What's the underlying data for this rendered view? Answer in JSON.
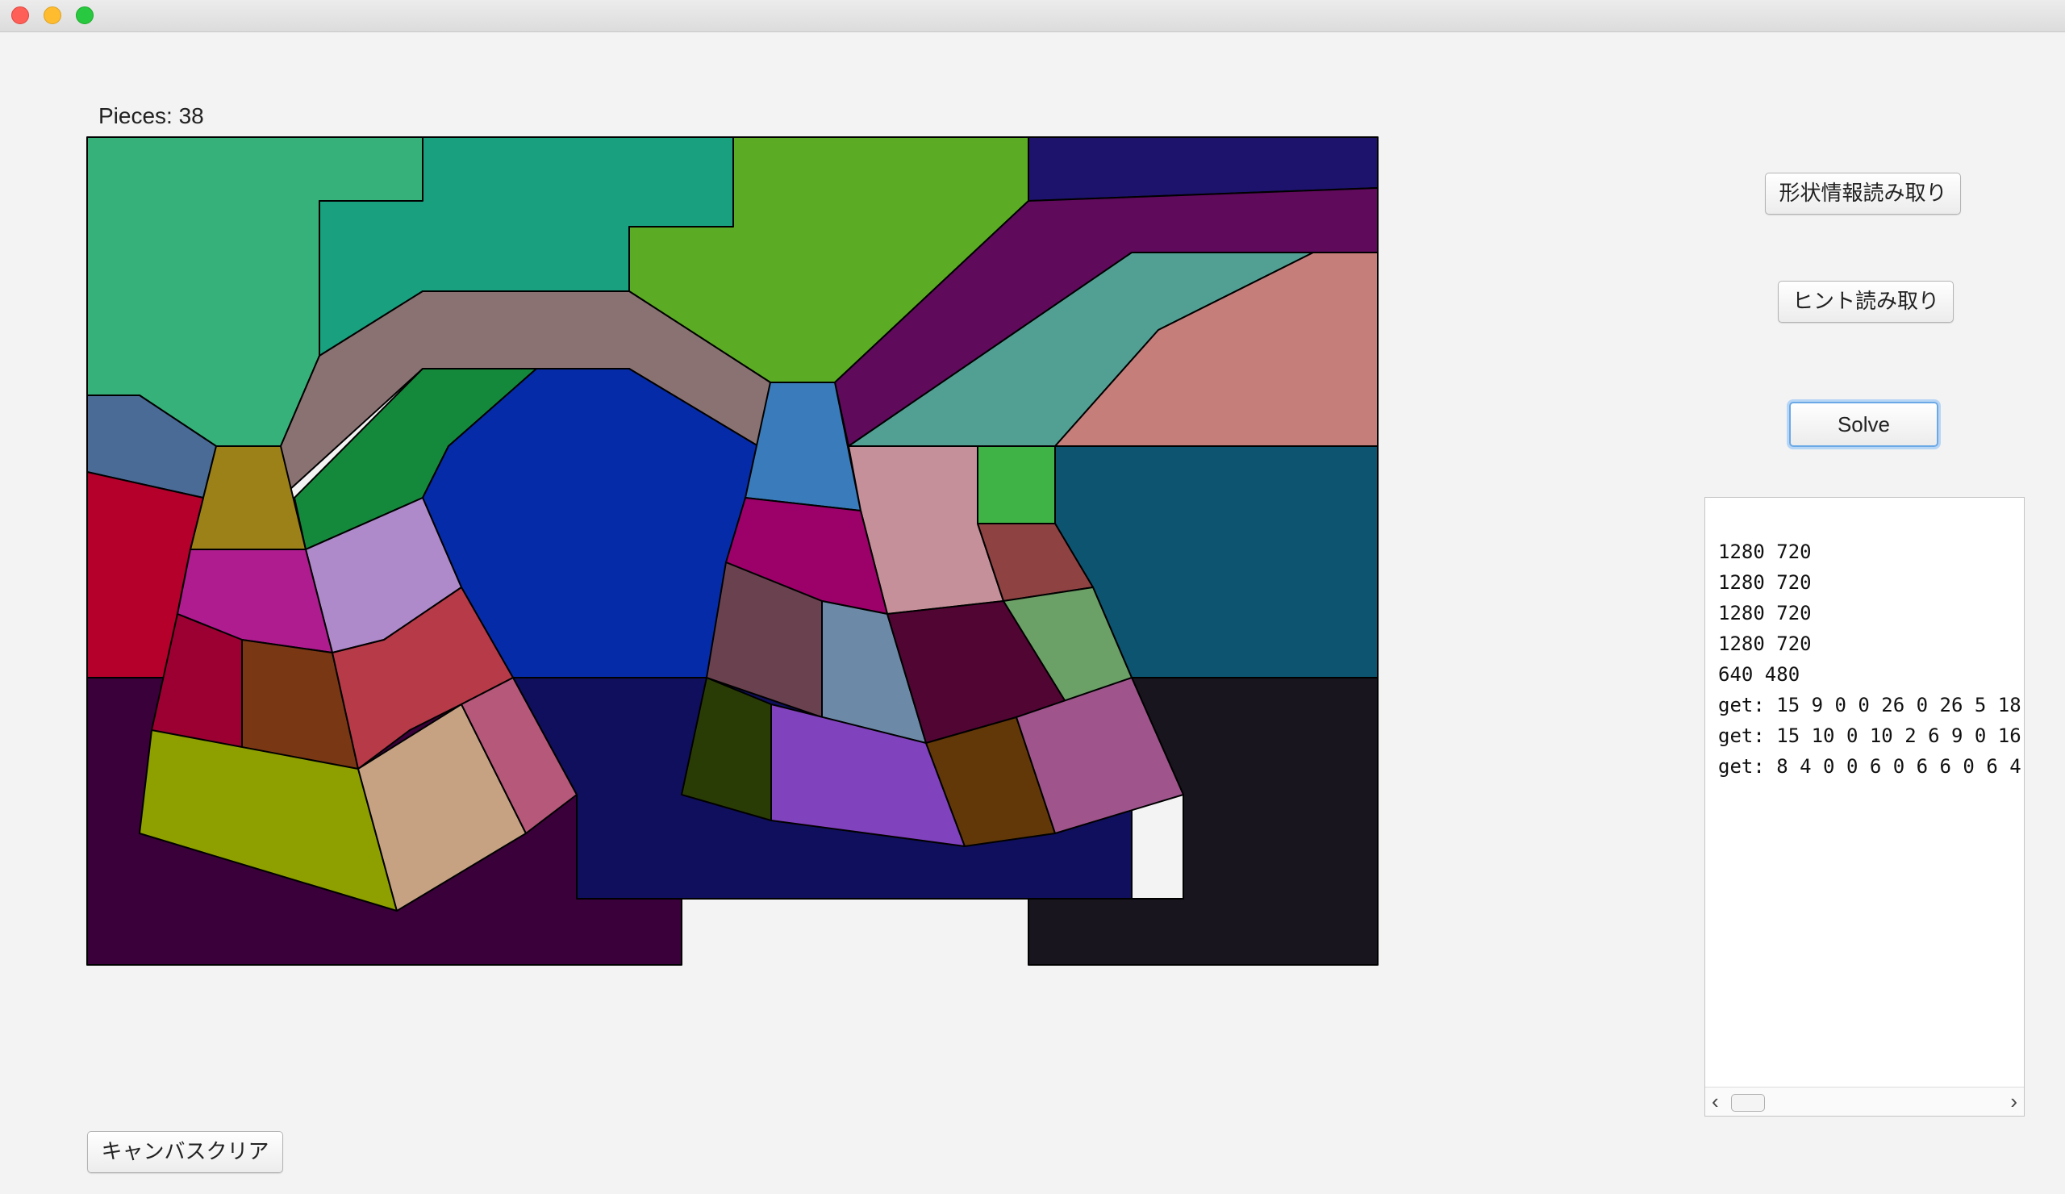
{
  "window": {
    "title": ""
  },
  "status": {
    "pieces_label": "Pieces:",
    "pieces_count": "38"
  },
  "buttons": {
    "load_shape": "形状情報読み取り",
    "load_hint": "ヒント読み取り",
    "solve": "Solve",
    "clear_canvas": "キャンバスクリア"
  },
  "console": {
    "lines": [
      "1280 720",
      "1280 720",
      "1280 720",
      "1280 720",
      "640 480",
      "get: 15 9 0 0 26 0 26 5 18",
      "get: 15 10 0 10 2 6 9 0 16",
      "get: 8 4 0 0 6 0 6 6 0 6 4"
    ]
  },
  "colors": {
    "background": "#f3f3f3",
    "piece_stroke": "#000000"
  },
  "puzzle": {
    "pieces": [
      {
        "id": "p1",
        "color": "#37b17a"
      },
      {
        "id": "p2",
        "color": "#18a07f"
      },
      {
        "id": "p3",
        "color": "#5bab24"
      },
      {
        "id": "p4",
        "color": "#1d136c"
      },
      {
        "id": "p5",
        "color": "#5f0a5b"
      },
      {
        "id": "p6",
        "color": "#52a094"
      },
      {
        "id": "p7",
        "color": "#c67e7b"
      },
      {
        "id": "p8",
        "color": "#8b7272"
      },
      {
        "id": "p9",
        "color": "#4a6b96"
      },
      {
        "id": "p10",
        "color": "#9c8118"
      },
      {
        "id": "p11",
        "color": "#14893c"
      },
      {
        "id": "p12",
        "color": "#062ba8"
      },
      {
        "id": "p13",
        "color": "#3a7cbb"
      },
      {
        "id": "p14",
        "color": "#0d5471"
      },
      {
        "id": "p15",
        "color": "#b5002b"
      },
      {
        "id": "p16",
        "color": "#c6909a"
      },
      {
        "id": "p17",
        "color": "#3fb345"
      },
      {
        "id": "p18",
        "color": "#ae8acb"
      },
      {
        "id": "p19",
        "color": "#ae1c8f"
      },
      {
        "id": "p20",
        "color": "#9c0069"
      },
      {
        "id": "p21",
        "color": "#8f4242"
      },
      {
        "id": "p22",
        "color": "#390039"
      },
      {
        "id": "p23",
        "color": "#9c0033"
      },
      {
        "id": "p24",
        "color": "#7a3714"
      },
      {
        "id": "p25",
        "color": "#b63a48"
      },
      {
        "id": "p26",
        "color": "#6a424f"
      },
      {
        "id": "p27",
        "color": "#6c8aa8"
      },
      {
        "id": "p28",
        "color": "#510533"
      },
      {
        "id": "p29",
        "color": "#6ba067"
      },
      {
        "id": "p30",
        "color": "#0f0f5e"
      },
      {
        "id": "p31",
        "color": "#18151f"
      },
      {
        "id": "p32",
        "color": "#8ea000"
      },
      {
        "id": "p33",
        "color": "#c6a283"
      },
      {
        "id": "p34",
        "color": "#b55879"
      },
      {
        "id": "p35",
        "color": "#2a3c06"
      },
      {
        "id": "p36",
        "color": "#8042bd"
      },
      {
        "id": "p37",
        "color": "#623809"
      },
      {
        "id": "p38",
        "color": "#9f558c"
      }
    ]
  }
}
